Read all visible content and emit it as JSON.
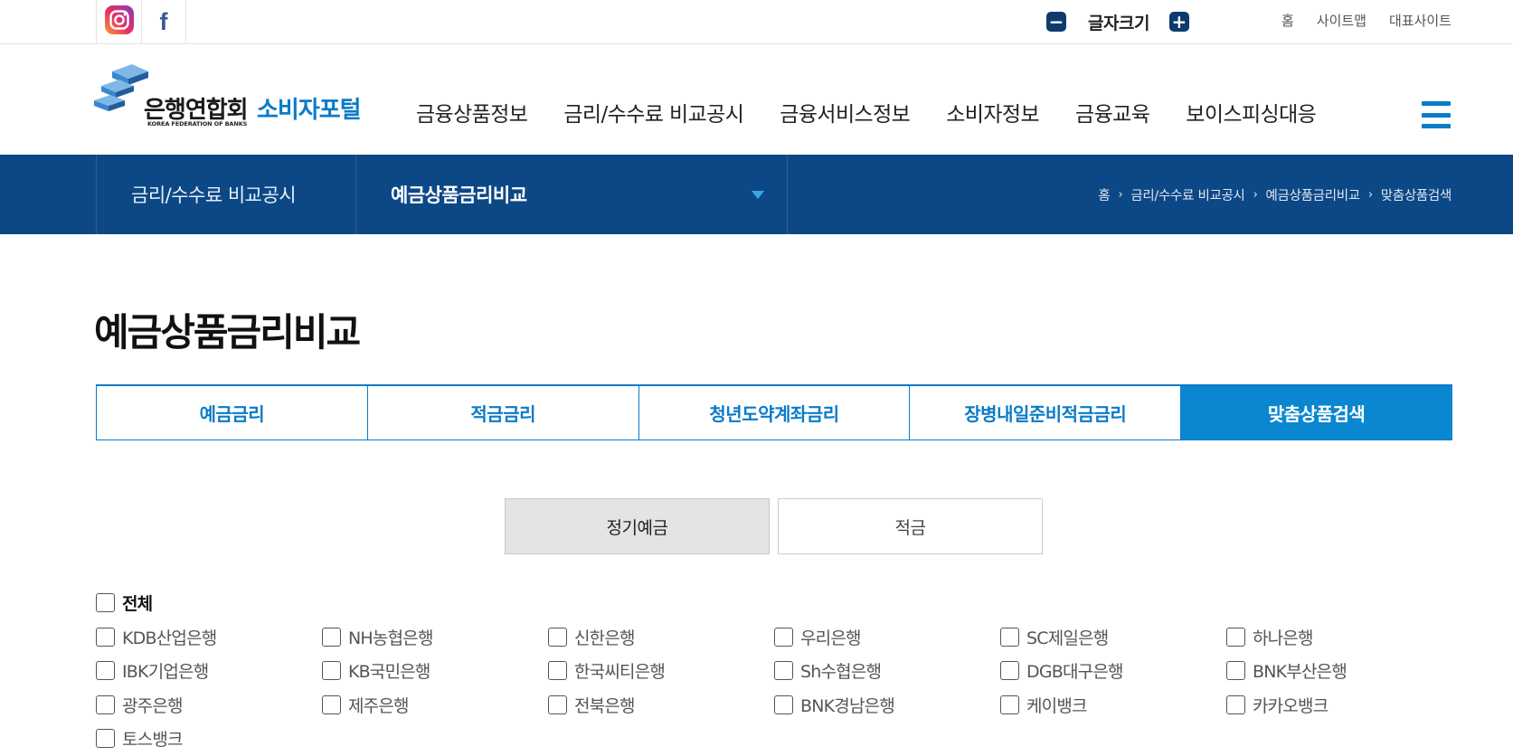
{
  "topbar": {
    "sns": [
      {
        "name": "instagram-icon"
      },
      {
        "name": "facebook-icon",
        "glyph": "f"
      }
    ],
    "fontsize": {
      "decrease": "−",
      "label": "글자크기",
      "increase": "+"
    },
    "links": [
      "홈",
      "사이트맵",
      "대표사이트"
    ]
  },
  "header": {
    "logo": {
      "name": "은행연합회",
      "sub": "KOREA FEDERATION OF BANKS",
      "portal": "소비자포털"
    },
    "gnb": [
      "금융상품정보",
      "금리/수수료 비교공시",
      "금융서비스정보",
      "소비자정보",
      "금융교육",
      "보이스피싱대응"
    ]
  },
  "subnav": {
    "depth1": "금리/수수료 비교공시",
    "depth2": "예금상품금리비교",
    "breadcrumb": [
      "홈",
      "금리/수수료 비교공시",
      "예금상품금리비교",
      "맞춤상품검색"
    ]
  },
  "page": {
    "title": "예금상품금리비교",
    "tabs": [
      {
        "label": "예금금리",
        "active": false
      },
      {
        "label": "적금금리",
        "active": false
      },
      {
        "label": "청년도약계좌금리",
        "active": false
      },
      {
        "label": "장병내일준비적금금리",
        "active": false
      },
      {
        "label": "맞춤상품검색",
        "active": true
      }
    ],
    "types": [
      {
        "label": "정기예금",
        "active": true
      },
      {
        "label": "적금",
        "active": false
      }
    ],
    "banks": {
      "all": "전체",
      "list": [
        "KDB산업은행",
        "NH농협은행",
        "신한은행",
        "우리은행",
        "SC제일은행",
        "하나은행",
        "IBK기업은행",
        "KB국민은행",
        "한국씨티은행",
        "Sh수협은행",
        "DGB대구은행",
        "BNK부산은행",
        "광주은행",
        "제주은행",
        "전북은행",
        "BNK경남은행",
        "케이뱅크",
        "카카오뱅크",
        "토스뱅크"
      ]
    }
  },
  "colors": {
    "navy": "#0d4886",
    "brand_blue": "#0a7bc8",
    "active_tab": "#0a87d0"
  }
}
